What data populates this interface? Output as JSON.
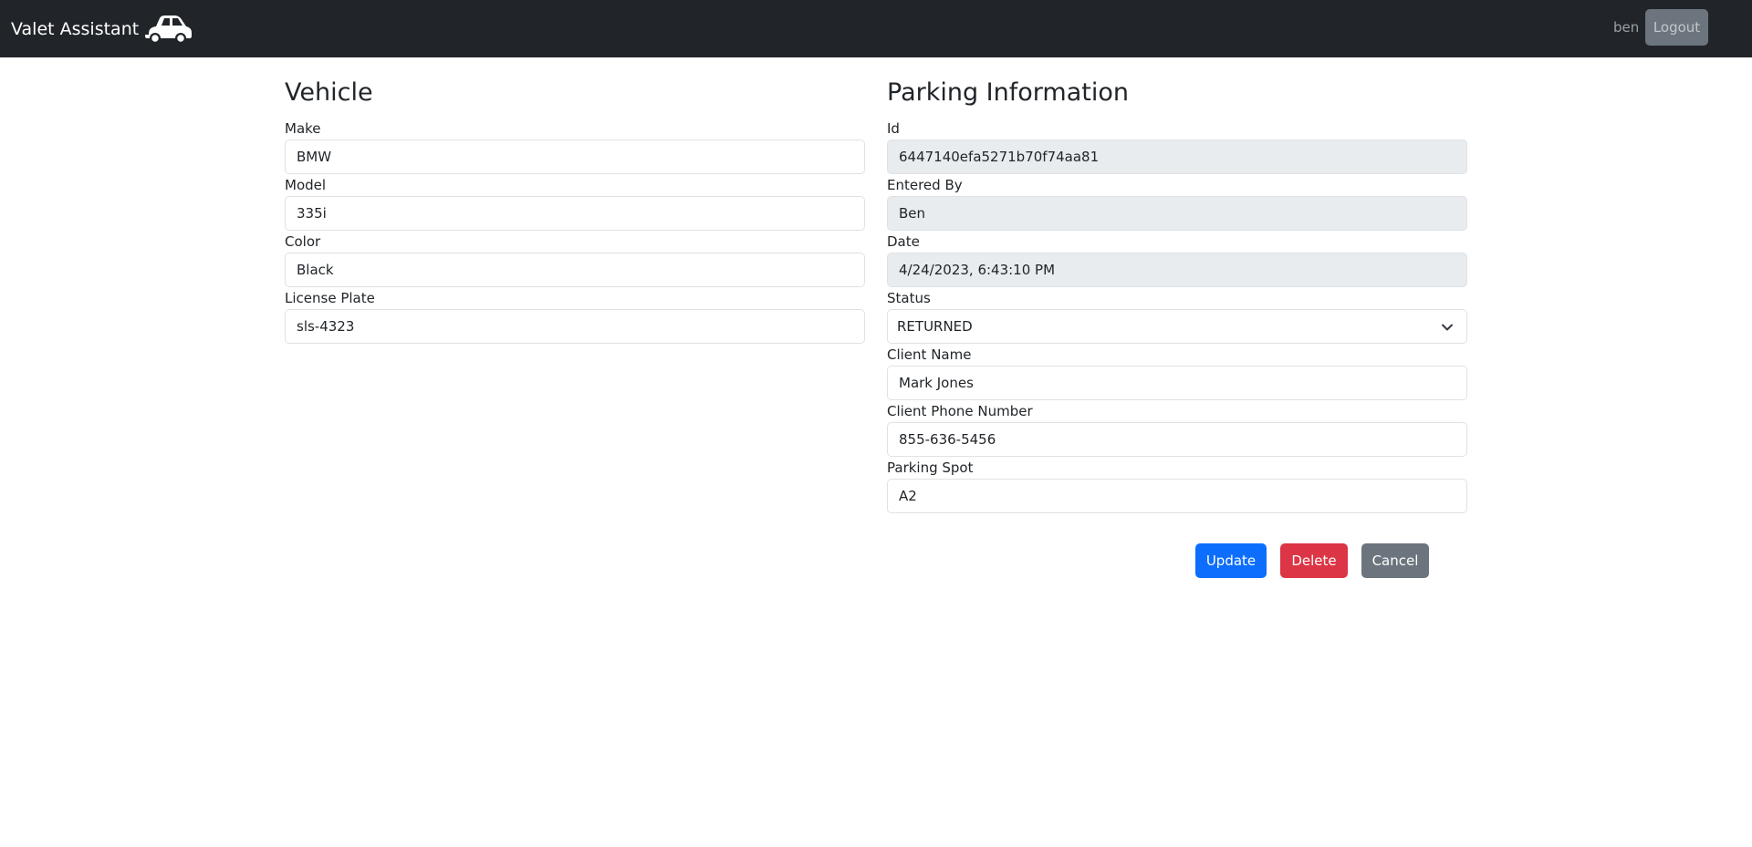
{
  "app": {
    "brand": "Valet Assistant",
    "brand_icon": "car-icon"
  },
  "nav": {
    "username": "ben",
    "logout_label": "Logout"
  },
  "vehicle": {
    "heading": "Vehicle",
    "fields": [
      {
        "label": "Make",
        "value": "BMW"
      },
      {
        "label": "Model",
        "value": "335i"
      },
      {
        "label": "Color",
        "value": "Black"
      },
      {
        "label": "License Plate",
        "value": "sls-4323"
      }
    ]
  },
  "parking": {
    "heading": "Parking Information",
    "id": {
      "label": "Id",
      "value": "6447140efa5271b70f74aa81"
    },
    "entered_by": {
      "label": "Entered By",
      "value": "Ben"
    },
    "date": {
      "label": "Date",
      "value": "4/24/2023, 6:43:10 PM"
    },
    "status": {
      "label": "Status",
      "value": "RETURNED"
    },
    "client_name": {
      "label": "Client Name",
      "value": "Mark Jones"
    },
    "client_phone": {
      "label": "Client Phone Number",
      "value": "855-636-5456"
    },
    "parking_spot": {
      "label": "Parking Spot",
      "value": "A2"
    }
  },
  "actions": {
    "update_label": "Update",
    "delete_label": "Delete",
    "cancel_label": "Cancel"
  },
  "colors": {
    "navbar": "#212529",
    "primary": "#0d6efd",
    "danger": "#dc3545",
    "secondary": "#6c757d",
    "readonly_bg": "#e9ecef"
  }
}
